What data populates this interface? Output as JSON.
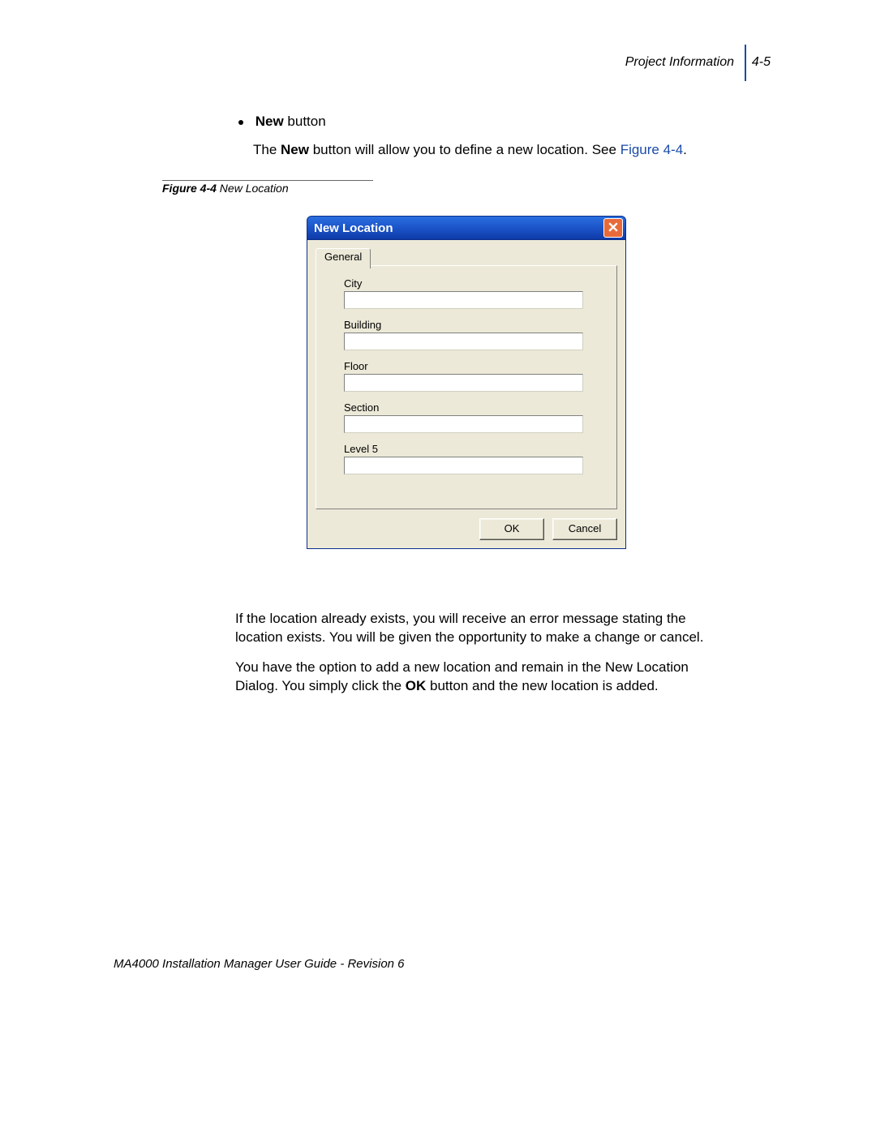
{
  "header": {
    "section": "Project Information",
    "pagenum": "4-5"
  },
  "body": {
    "bullet_bold": "New",
    "bullet_rest": " button",
    "p1_a": "The ",
    "p1_bold": "New",
    "p1_b": " button will allow you to define a new location. See ",
    "p1_link": "Figure 4-4",
    "p1_c": ".",
    "p2": "If the location already exists, you will receive an error message stating the location exists. You will be given the opportunity to make a change or cancel.",
    "p3_a": "You have the option to add a new location and remain in the New Location Dialog. You simply click the ",
    "p3_bold": "OK",
    "p3_b": " button and the new location is added."
  },
  "figure": {
    "label_bold": "Figure 4-4",
    "label_rest": "  New Location"
  },
  "dialog": {
    "title": "New Location",
    "tab": "General",
    "fields": [
      {
        "label": "City",
        "value": ""
      },
      {
        "label": "Building",
        "value": ""
      },
      {
        "label": "Floor",
        "value": ""
      },
      {
        "label": "Section",
        "value": ""
      },
      {
        "label": "Level 5",
        "value": ""
      }
    ],
    "ok": "OK",
    "cancel": "Cancel"
  },
  "footer": "MA4000 Installation Manager User Guide - Revision 6"
}
